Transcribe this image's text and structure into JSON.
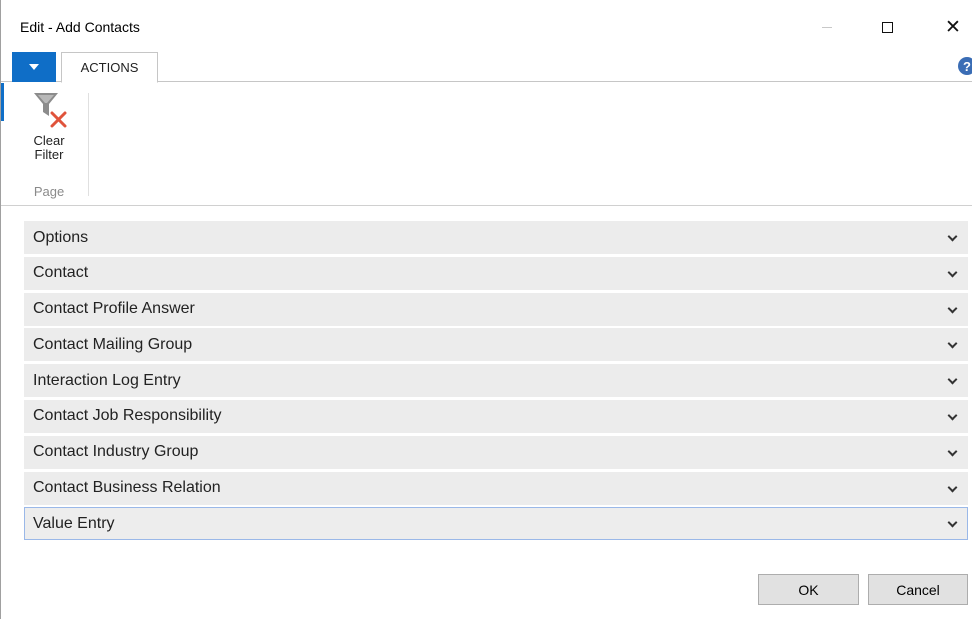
{
  "window": {
    "title": "Edit - Add Contacts"
  },
  "ribbon": {
    "tab_actions": "ACTIONS",
    "action_clear_filter": "Clear\nFilter",
    "action_clear_filter_line1": "Clear",
    "action_clear_filter_line2": "Filter",
    "group_page": "Page",
    "help_glyph": "?"
  },
  "sections": [
    {
      "label": "Options"
    },
    {
      "label": "Contact"
    },
    {
      "label": "Contact Profile Answer"
    },
    {
      "label": "Contact Mailing Group"
    },
    {
      "label": "Interaction Log Entry"
    },
    {
      "label": "Contact Job Responsibility"
    },
    {
      "label": "Contact Industry Group"
    },
    {
      "label": "Contact Business Relation"
    },
    {
      "label": "Value Entry"
    }
  ],
  "selected_section": "Value Entry",
  "footer": {
    "ok_label": "OK",
    "cancel_label": "Cancel"
  },
  "colors": {
    "accent": "#0f6ec7",
    "section_bg": "#ececec",
    "selected_border": "#9ab8e8",
    "filter_x": "#e0533b"
  },
  "icons": {
    "menu": "caret-down-icon",
    "help": "help-icon",
    "clear_filter": "clear-filter-icon",
    "expand": "chevron-down-icon",
    "minimize": "minimize-icon",
    "maximize": "maximize-icon",
    "close": "close-icon"
  }
}
